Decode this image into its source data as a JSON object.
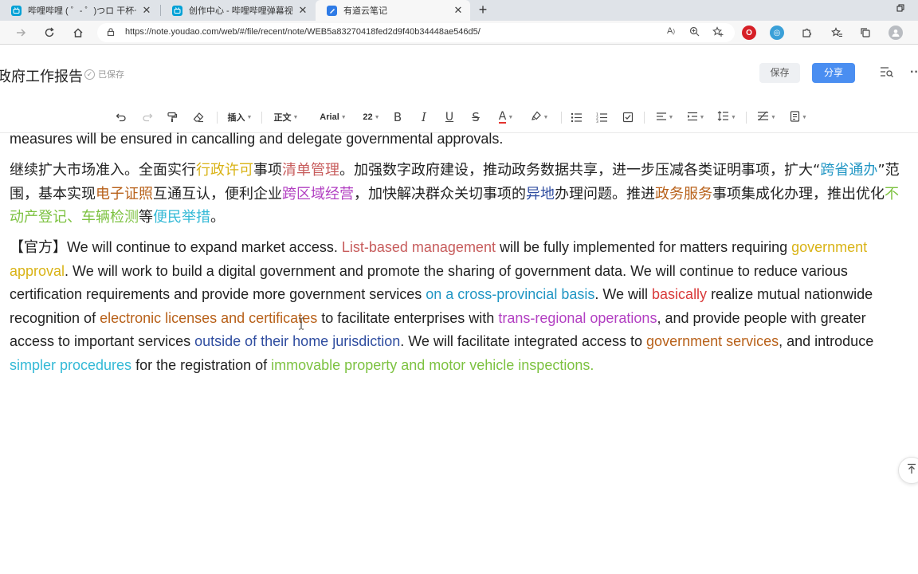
{
  "browser": {
    "tabs": [
      {
        "title": "哔哩哔哩 ( ゜- ゜)つロ 干杯~-bilibili",
        "favicon": "bilibili-icon",
        "active": false
      },
      {
        "title": "创作中心 - 哔哩哔哩弹幕视频网",
        "favicon": "bilibili-icon",
        "active": false
      },
      {
        "title": "有道云笔记",
        "favicon": "youdao-note-icon",
        "active": true
      }
    ],
    "new_tab": "+",
    "url": "https://note.youdao.com/web/#/file/recent/note/WEB5a83270418fed2d9f40b34448ae546d5/"
  },
  "note": {
    "title": "政府工作报告",
    "saved_status": "已保存",
    "save_button": "保存",
    "share_button": "分享"
  },
  "toolbar": {
    "insert": "插入",
    "style": "正文",
    "font": "Arial",
    "size": "22"
  },
  "content": {
    "p1": "measures will be ensured in cancalling and delegate governmental approvals.",
    "p2": [
      {
        "t": "继续扩大市场准入。全面实行",
        "c": ""
      },
      {
        "t": "行政许可",
        "c": "yellow"
      },
      {
        "t": "事项",
        "c": ""
      },
      {
        "t": "清单管理",
        "c": "rose"
      },
      {
        "t": "。加强数字政府建设，推动政务数据共享，进一步压减各类证明事项，扩大“",
        "c": ""
      },
      {
        "t": "跨省通办",
        "c": "blue"
      },
      {
        "t": "”范围，基本实现",
        "c": ""
      },
      {
        "t": "电子证照",
        "c": "brown"
      },
      {
        "t": "互通互认，便利企业",
        "c": ""
      },
      {
        "t": "跨区域经营",
        "c": "purple"
      },
      {
        "t": "，加快解决群众关切事项的",
        "c": ""
      },
      {
        "t": "异地",
        "c": "navy"
      },
      {
        "t": "办理问题。推进",
        "c": ""
      },
      {
        "t": "政务服务",
        "c": "brown"
      },
      {
        "t": "事项集成化办理，推出优化",
        "c": ""
      },
      {
        "t": "不动产登记、车辆检测",
        "c": "green"
      },
      {
        "t": "等",
        "c": ""
      },
      {
        "t": "便民举措",
        "c": "cyan"
      },
      {
        "t": "。",
        "c": ""
      }
    ],
    "p3": [
      {
        "t": "【官方】We will continue to expand market access. ",
        "c": ""
      },
      {
        "t": "List-based management",
        "c": "rose"
      },
      {
        "t": " will be fully implemented for matters requiring ",
        "c": ""
      },
      {
        "t": "government approval",
        "c": "yellow"
      },
      {
        "t": ". We will work to build a digital government and promote the sharing of government data. We will continue to reduce various certification requirements and provide more government services ",
        "c": ""
      },
      {
        "t": "on a cross-provincial basis",
        "c": "blue"
      },
      {
        "t": ". We will ",
        "c": ""
      },
      {
        "t": "basically",
        "c": "red"
      },
      {
        "t": " realize mutual nationwide recognition of ",
        "c": ""
      },
      {
        "t": "electronic licenses and certificates",
        "c": "brown"
      },
      {
        "t": " to facilitate enterprises with ",
        "c": ""
      },
      {
        "t": "trans-regional operations",
        "c": "purple"
      },
      {
        "t": ", and provide people with greater access to important services ",
        "c": ""
      },
      {
        "t": "outside of their home jurisdiction",
        "c": "navy"
      },
      {
        "t": ". We will facilitate integrated access to ",
        "c": ""
      },
      {
        "t": "government services",
        "c": "brown"
      },
      {
        "t": ", and introduce ",
        "c": ""
      },
      {
        "t": "simpler procedures",
        "c": "cyan"
      },
      {
        "t": " for the registration of ",
        "c": ""
      },
      {
        "t": "immovable property and motor vehicle inspections.",
        "c": "green"
      }
    ]
  },
  "colors": {
    "yellow": "#d9b316",
    "rose": "#c75c5c",
    "blue": "#2196c4",
    "brown": "#b8611a",
    "purple": "#b23fc2",
    "navy": "#2f4da0",
    "green": "#7dc241",
    "cyan": "#33b9d6",
    "red": "#d93a3a",
    "share_button": "#4a8ef1"
  }
}
